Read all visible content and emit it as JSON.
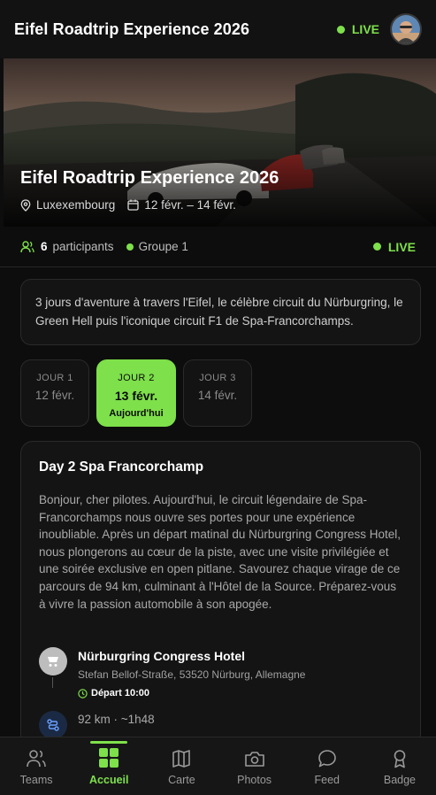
{
  "header": {
    "title": "Eifel Roadtrip Experience 2026",
    "live_label": "LIVE"
  },
  "hero": {
    "title": "Eifel Roadtrip Experience 2026",
    "location": "Luxexembourg",
    "dates": "12 févr. – 14 févr."
  },
  "stats": {
    "participants_count": "6",
    "participants_label": "participants",
    "group": "Groupe 1",
    "live_label": "LIVE"
  },
  "description": "3 jours d'aventure à travers l'Eifel, le célèbre circuit du Nürburgring, le Green Hell puis l'iconique circuit F1 de Spa-Francorchamps.",
  "days": [
    {
      "label": "JOUR 1",
      "date": "12 févr."
    },
    {
      "label": "JOUR 2",
      "date": "13 févr.",
      "today": "Aujourd'hui"
    },
    {
      "label": "JOUR 3",
      "date": "14 févr."
    }
  ],
  "day_card": {
    "title": "Day 2 Spa Francorchamp",
    "body": "Bonjour, cher pilotes. Aujourd'hui, le circuit légendaire de Spa-Francorchamps nous ouvre ses portes pour une expérience inoubliable. Après un départ matinal du Nürburgring Congress Hotel, nous plongerons au cœur de la piste, avec une visite privilégiée et une soirée exclusive en open pitlane. Savourez chaque virage de ce parcours de 94 km, culminant à l'Hôtel de la Source. Préparez-vous à vivre la passion automobile à son apogée.",
    "stop": {
      "name": "Nürburgring Congress Hotel",
      "address": "Stefan Bellof-Straße, 53520 Nürburg, Allemagne",
      "departure": "Départ 10:00"
    },
    "route": "92 km · ~1h48"
  },
  "nav": [
    {
      "label": "Teams",
      "icon": "users-icon"
    },
    {
      "label": "Accueil",
      "icon": "grid-icon"
    },
    {
      "label": "Carte",
      "icon": "map-icon"
    },
    {
      "label": "Photos",
      "icon": "camera-icon"
    },
    {
      "label": "Feed",
      "icon": "chat-icon"
    },
    {
      "label": "Badge",
      "icon": "badge-icon"
    }
  ],
  "colors": {
    "accent": "#7ee04a",
    "background": "#0d0d0d",
    "card": "#141414"
  }
}
